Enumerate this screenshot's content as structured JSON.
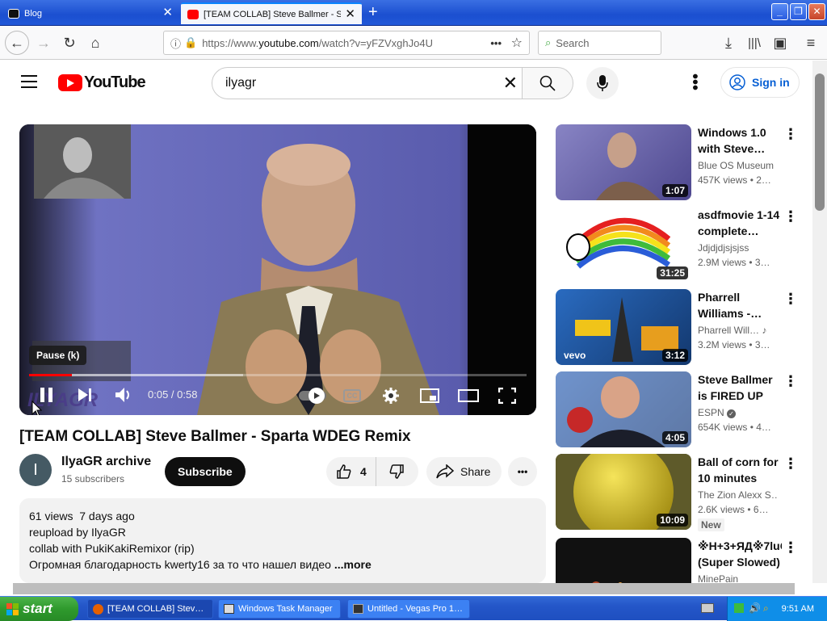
{
  "browser": {
    "tabs": [
      {
        "label": "Blog"
      },
      {
        "label": "[TEAM COLLAB] Steve Ballmer - Sp"
      }
    ],
    "url_prefix": "https://www.",
    "url_domain": "youtube.com",
    "url_path": "/watch?v=yFZVxghJo4U",
    "search_placeholder": "Search"
  },
  "youtube": {
    "logo_text": "YouTube",
    "search_query": "ilyagr",
    "signin_label": "Sign in",
    "player": {
      "tooltip": "Pause (k)",
      "time": "0:05 / 0:58",
      "progress": 0.086,
      "buffered": 0.43,
      "watermark": "ILYAGR"
    },
    "video_title": "[TEAM COLLAB] Steve Ballmer - Sparta WDEG Remix",
    "channel": {
      "avatar_letter": "I",
      "name": "IlyaGR archive",
      "subscribers": "15 subscribers",
      "subscribe_label": "Subscribe",
      "likes": "4",
      "share_label": "Share"
    },
    "description": {
      "stats": "61 views  7 days ago",
      "line1": "reupload by IlyaGR",
      "line2": "collab with PukiKakiRemixor (rip)",
      "line3": "Огромная благодарность kwerty16 за то что нашел видео",
      "more": "...more"
    },
    "recommendations": [
      {
        "title": "Windows 1.0 with Steve…",
        "channel": "Blue OS Museum",
        "views": "457K views  • 2…",
        "duration": "1:07",
        "thumb_color": "#6b63a8"
      },
      {
        "title": "asdfmovie 1-14 complete…",
        "channel": "Jdjdjdjsjsjss",
        "views": "2.9M views  • 3…",
        "duration": "31:25",
        "thumb_color": "#ffffff"
      },
      {
        "title": "Pharrell Williams -…",
        "channel": "Pharrell Will…",
        "views": "3.2M views  • 3…",
        "duration": "3:12",
        "thumb_color": "#1c5aa8"
      },
      {
        "title": "Steve Ballmer is FIRED UP at…",
        "channel": "ESPN",
        "views": "654K views  • 4…",
        "duration": "4:05",
        "thumb_color": "#1d4fa0"
      },
      {
        "title": "Ball of corn for 10 minutes",
        "channel": "The Zion Alexx S…",
        "views": "2.6K views  • 6…",
        "duration": "10:09",
        "thumb_color": "#b5a52a",
        "badge": "New"
      },
      {
        "title": "※H+3+ЯД※7luC (Super Slowed)",
        "channel": "MinePain",
        "views": "",
        "duration": "",
        "thumb_color": "#1a1a1a"
      }
    ]
  },
  "taskbar": {
    "start_label": "start",
    "tasks": [
      {
        "label": "[TEAM COLLAB] Stev…"
      },
      {
        "label": "Windows Task Manager"
      },
      {
        "label": "Untitled - Vegas Pro 1…"
      }
    ],
    "clock": "9:51 AM"
  },
  "colors": {
    "yt_red": "#ff0000",
    "link_blue": "#065fd4",
    "xp_blue": "#2456c8",
    "xp_green": "#2f9a2d"
  }
}
